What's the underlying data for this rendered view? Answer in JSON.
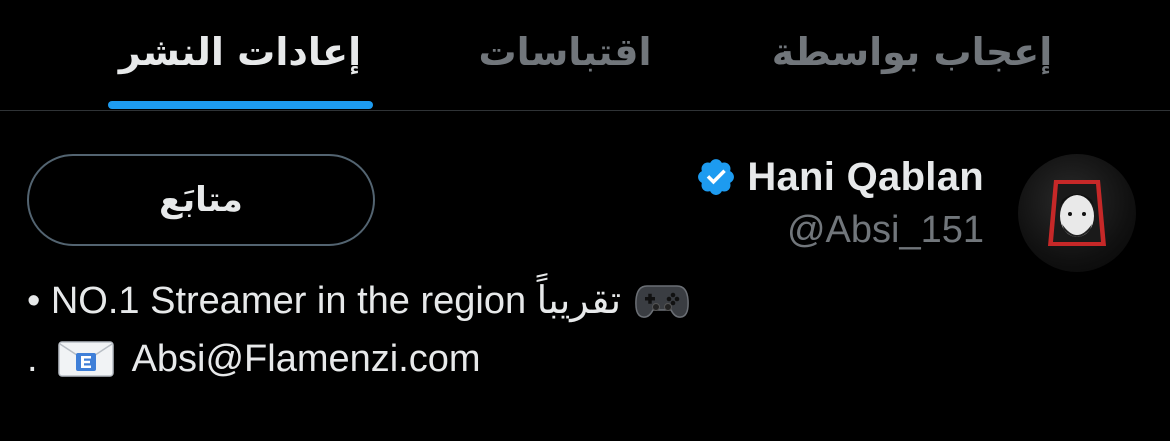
{
  "tabs": [
    {
      "label": "إعجاب بواسطة",
      "active": false
    },
    {
      "label": "اقتباسات",
      "active": false
    },
    {
      "label": "إعادات النشر",
      "active": true
    }
  ],
  "user": {
    "display_name": "Hani Qablan",
    "handle": "@Absi_151",
    "verified": true,
    "follow_label": "متابَع"
  },
  "bio": {
    "line1_text": "• NO.1 Streamer in the region تقريباً",
    "line1_icon": "video-game-controller-emoji",
    "line2_prefix": ".",
    "line2_icon": "envelope-e-emoji",
    "line2_text": "Absi@Flamenzi.com"
  },
  "colors": {
    "background": "#000000",
    "accent": "#1d9bf0",
    "text_primary": "#e7e9ea",
    "text_secondary": "#71767b"
  }
}
